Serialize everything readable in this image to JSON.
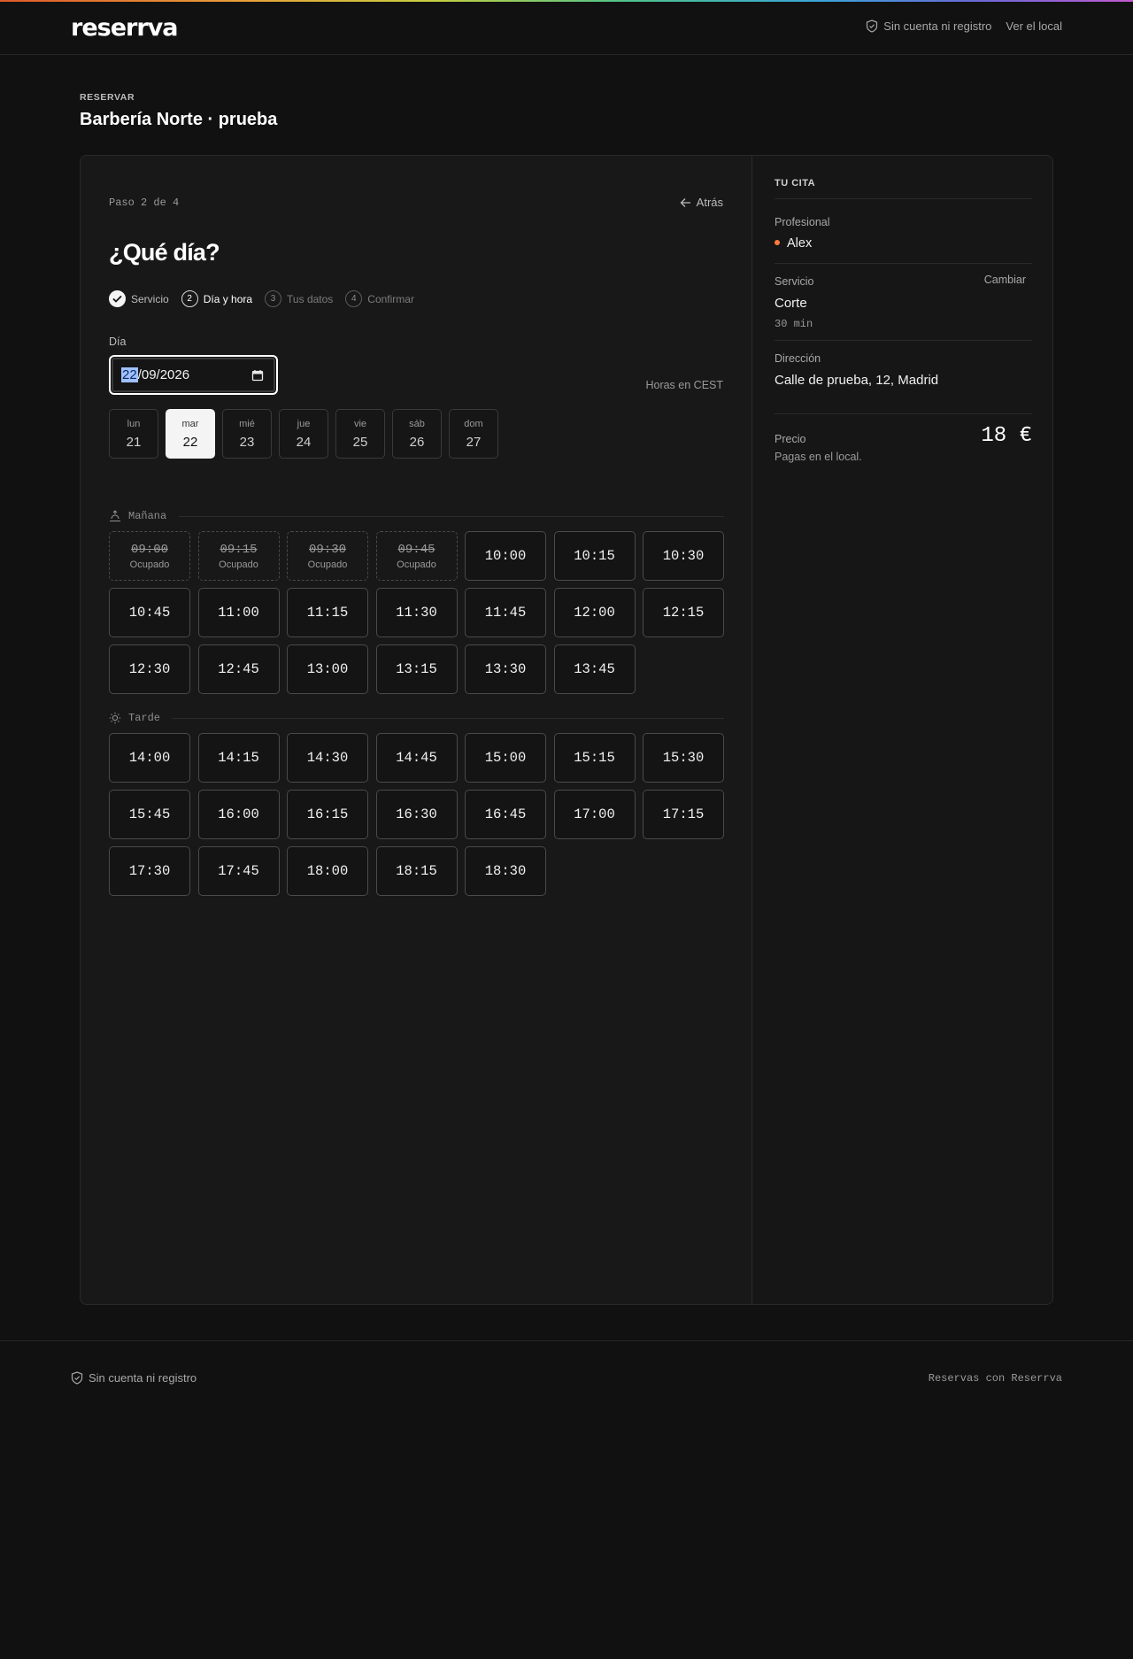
{
  "nav": {
    "logo": "reserrva",
    "no_account": "Sin cuenta ni registro",
    "view_local": "Ver el local"
  },
  "page": {
    "eyebrow": "RESERVAR",
    "title": "Barbería Norte · prueba"
  },
  "booking": {
    "step_label": "Paso 2 de 4",
    "back": "Atrás",
    "question": "¿Qué día?",
    "steps": [
      {
        "num": "1",
        "label": "Servicio",
        "state": "done"
      },
      {
        "num": "2",
        "label": "Día y hora",
        "state": "active"
      },
      {
        "num": "3",
        "label": "Tus datos",
        "state": "pending"
      },
      {
        "num": "4",
        "label": "Confirmar",
        "state": "pending"
      }
    ],
    "day_label": "Día",
    "date": {
      "day": "22",
      "month": "09",
      "year": "2026"
    },
    "timezone": "Horas en CEST",
    "days": [
      {
        "name": "lun",
        "num": "21"
      },
      {
        "name": "mar",
        "num": "22",
        "selected": true
      },
      {
        "name": "mié",
        "num": "23"
      },
      {
        "name": "jue",
        "num": "24"
      },
      {
        "name": "vie",
        "num": "25"
      },
      {
        "name": "sáb",
        "num": "26"
      },
      {
        "name": "dom",
        "num": "27"
      }
    ],
    "busy_label": "Ocupado",
    "morning": {
      "label": "Mañana",
      "slots": [
        {
          "time": "09:00",
          "busy": true
        },
        {
          "time": "09:15",
          "busy": true
        },
        {
          "time": "09:30",
          "busy": true
        },
        {
          "time": "09:45",
          "busy": true
        },
        {
          "time": "10:00"
        },
        {
          "time": "10:15"
        },
        {
          "time": "10:30"
        },
        {
          "time": "10:45"
        },
        {
          "time": "11:00"
        },
        {
          "time": "11:15"
        },
        {
          "time": "11:30"
        },
        {
          "time": "11:45"
        },
        {
          "time": "12:00"
        },
        {
          "time": "12:15"
        },
        {
          "time": "12:30"
        },
        {
          "time": "12:45"
        },
        {
          "time": "13:00"
        },
        {
          "time": "13:15"
        },
        {
          "time": "13:30"
        },
        {
          "time": "13:45"
        }
      ]
    },
    "afternoon": {
      "label": "Tarde",
      "slots": [
        {
          "time": "14:00"
        },
        {
          "time": "14:15"
        },
        {
          "time": "14:30"
        },
        {
          "time": "14:45"
        },
        {
          "time": "15:00"
        },
        {
          "time": "15:15"
        },
        {
          "time": "15:30"
        },
        {
          "time": "15:45"
        },
        {
          "time": "16:00"
        },
        {
          "time": "16:15"
        },
        {
          "time": "16:30"
        },
        {
          "time": "16:45"
        },
        {
          "time": "17:00"
        },
        {
          "time": "17:15"
        },
        {
          "time": "17:30"
        },
        {
          "time": "17:45"
        },
        {
          "time": "18:00"
        },
        {
          "time": "18:15"
        },
        {
          "time": "18:30"
        }
      ]
    }
  },
  "summary": {
    "title": "TU CITA",
    "professional_label": "Profesional",
    "professional": "Alex",
    "service_label": "Servicio",
    "change": "Cambiar",
    "service": "Corte",
    "duration": "30 min",
    "address_label": "Dirección",
    "address": "Calle de prueba, 12, Madrid",
    "price_label": "Precio",
    "price": "18 €",
    "pay_note": "Pagas en el local."
  },
  "footer": {
    "no_account": "Sin cuenta ni registro",
    "powered": "Reservas con Reserrva"
  },
  "colors": {
    "accent_dot": "#ff7a3d",
    "selected_day": "#f4f4f4",
    "background": "#111111"
  }
}
